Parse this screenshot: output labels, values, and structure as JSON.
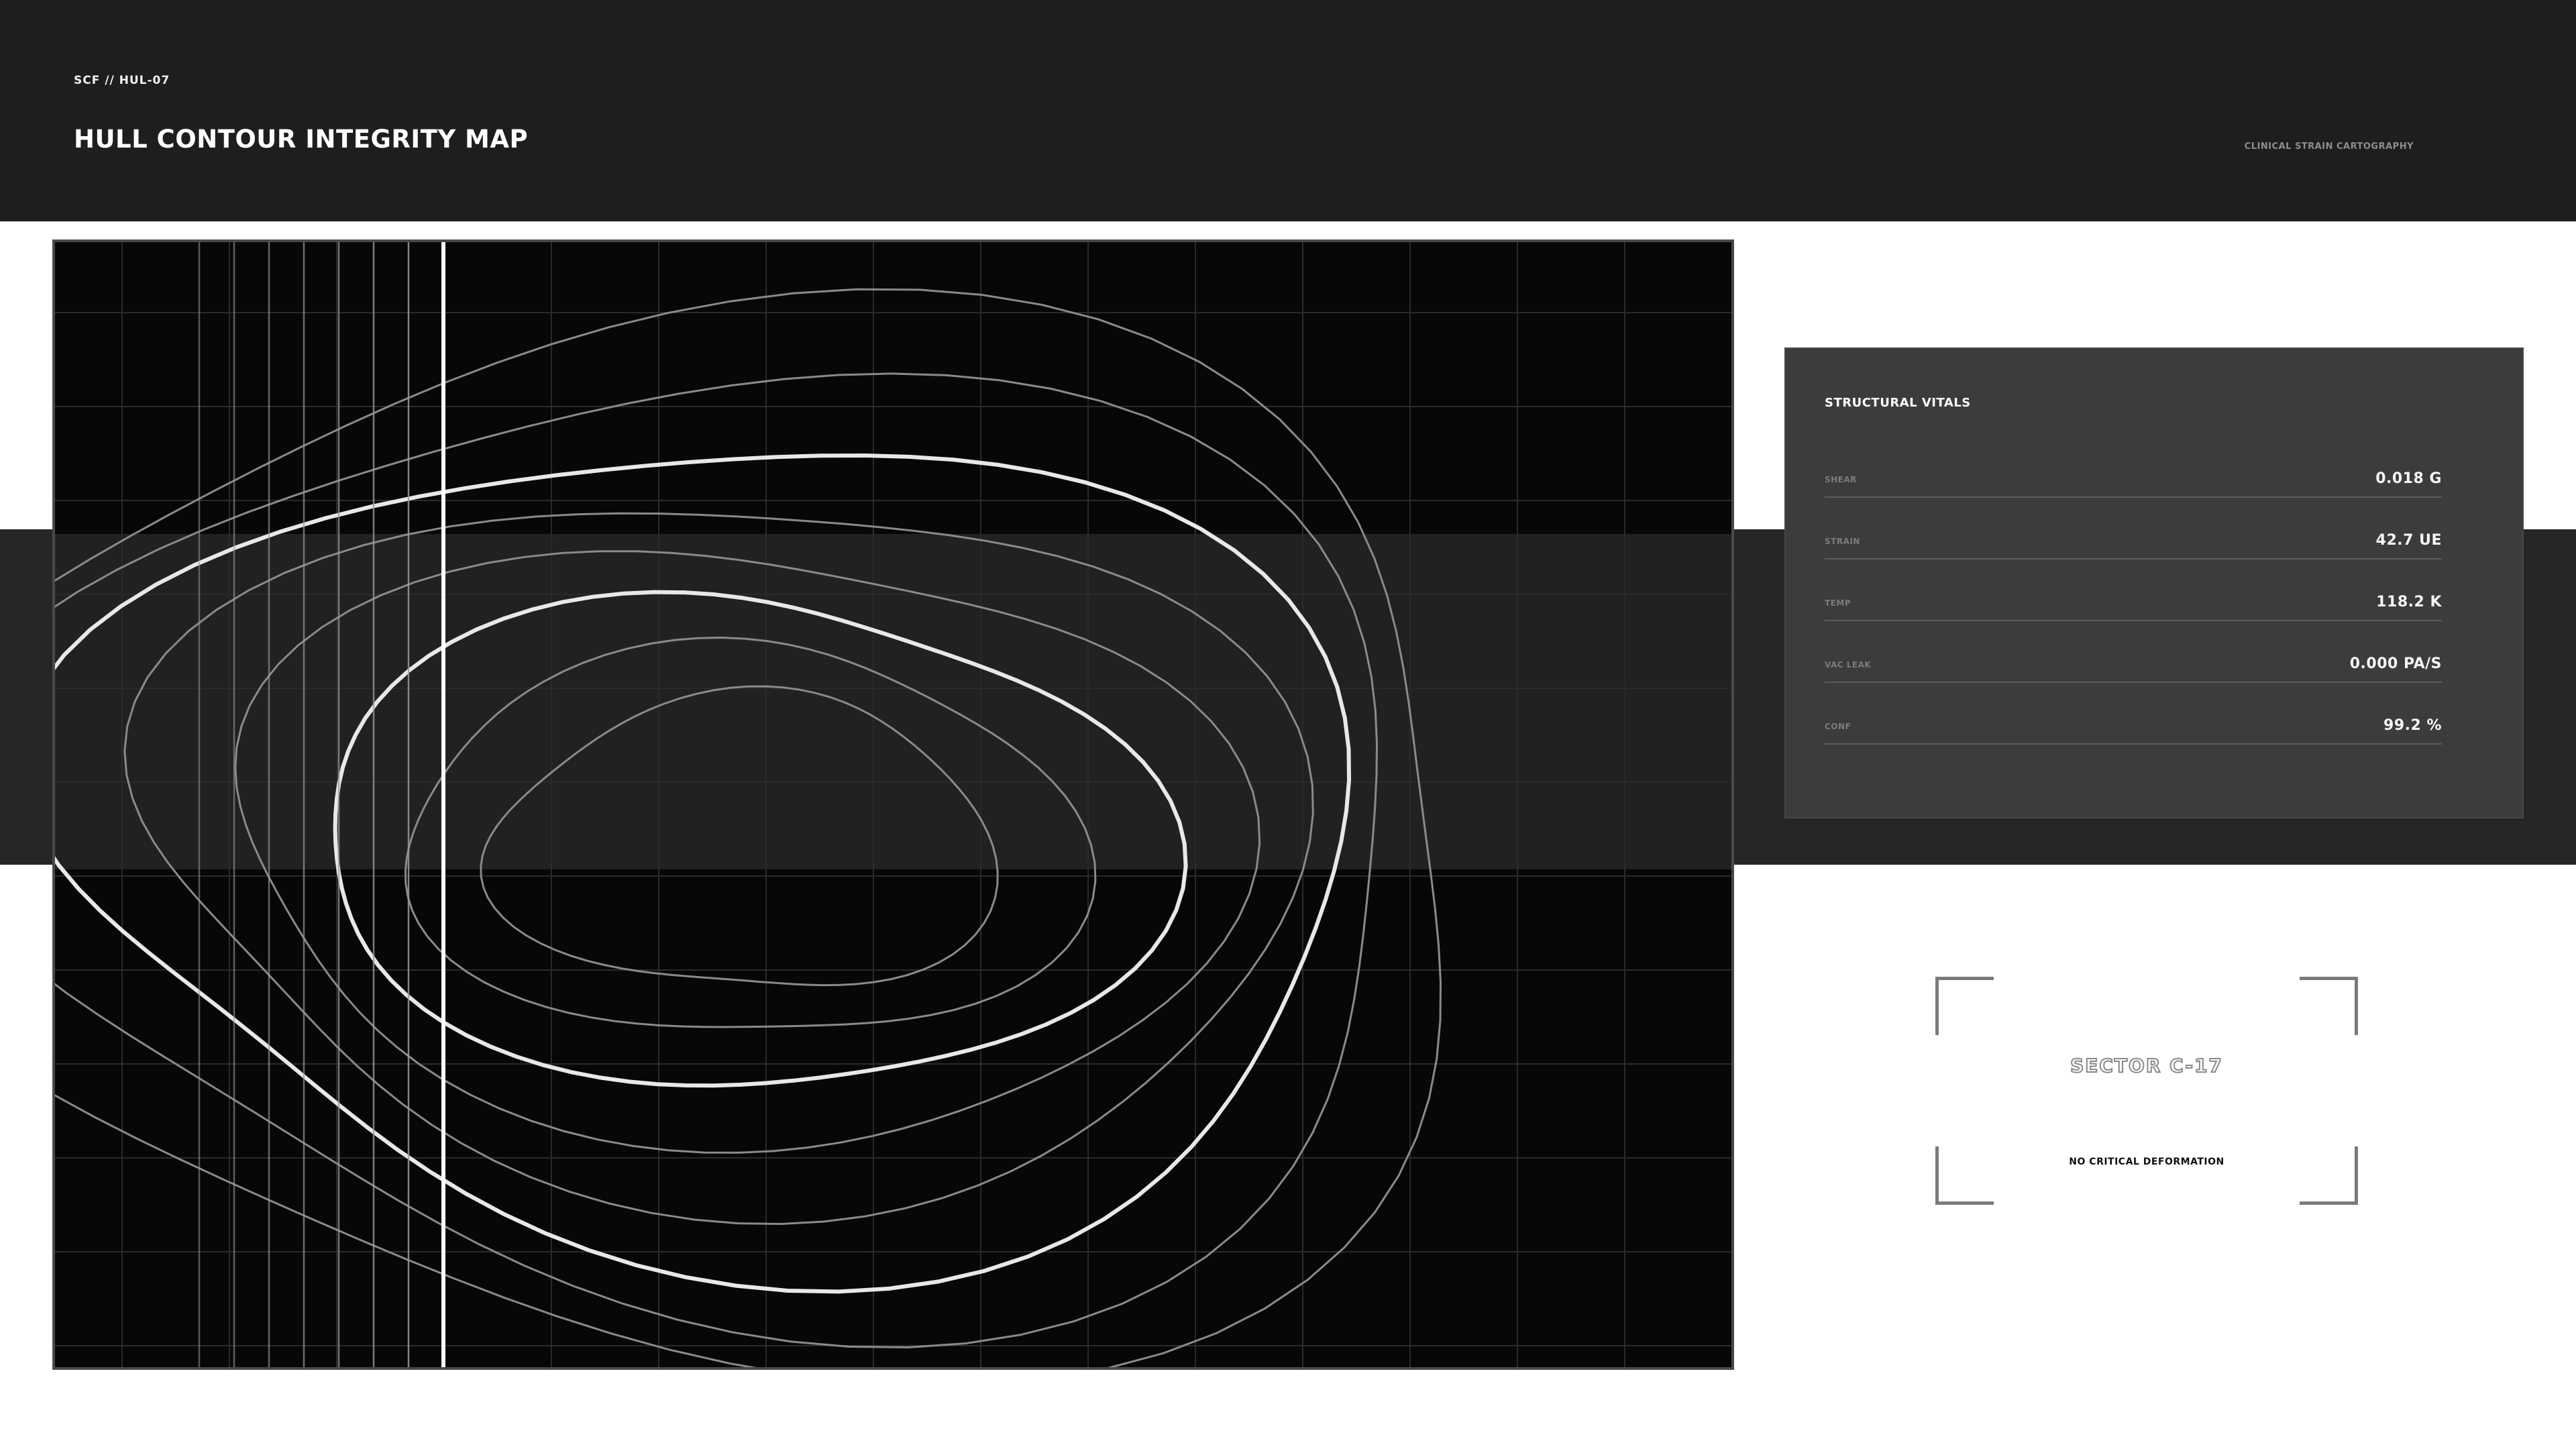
{
  "header": {
    "code": "SCF // HUL-07",
    "title": "HULL CONTOUR INTEGRITY MAP",
    "subtitle": "CLINICAL STRAIN CARTOGRAPHY"
  },
  "map": {
    "contour_count": 8,
    "scanlines": 8,
    "colors": {
      "background": "#070707",
      "contour": "#ffffff",
      "grid": "#2a2a2a"
    }
  },
  "vitals": {
    "title": "STRUCTURAL VITALS",
    "rows": [
      {
        "label": "SHEAR",
        "value": "0.018 G"
      },
      {
        "label": "STRAIN",
        "value": "42.7 UE"
      },
      {
        "label": "TEMP",
        "value": "118.2 K"
      },
      {
        "label": "VAC LEAK",
        "value": "0.000 PA/S"
      },
      {
        "label": "CONF",
        "value": "99.2 %"
      }
    ]
  },
  "sector": {
    "name": "SECTOR C-17",
    "status": "NO CRITICAL DEFORMATION"
  }
}
